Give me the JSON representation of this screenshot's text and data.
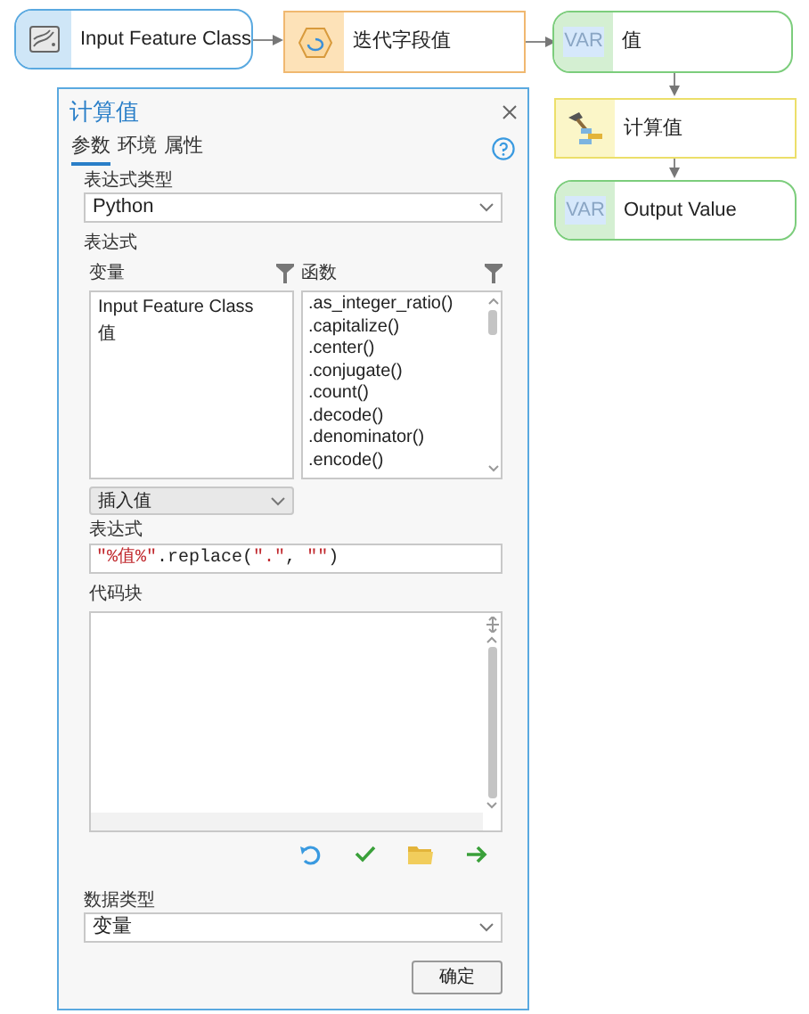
{
  "nodes": [
    {
      "kind": "data",
      "label": "Input Feature Class"
    },
    {
      "kind": "iterator",
      "label": "迭代字段值"
    },
    {
      "kind": "variable",
      "icon_text": "VAR",
      "label": "值"
    },
    {
      "kind": "tool",
      "label": "计算值"
    },
    {
      "kind": "variable",
      "icon_text": "VAR",
      "label": "Output Value"
    }
  ],
  "dialog": {
    "title": "计算值",
    "tabs": [
      {
        "label": "参数",
        "selected": true
      },
      {
        "label": "环境",
        "selected": false
      },
      {
        "label": "属性",
        "selected": false
      }
    ],
    "expression_type": {
      "label": "表达式类型",
      "value": "Python"
    },
    "expression_section": {
      "label": "表达式",
      "variables": {
        "heading": "变量",
        "items": [
          "Input Feature Class",
          "值"
        ]
      },
      "functions": {
        "heading": "函数",
        "items": [
          ".as_integer_ratio()",
          ".capitalize()",
          ".center()",
          ".conjugate()",
          ".count()",
          ".decode()",
          ".denominator()",
          ".encode()"
        ]
      },
      "insert_value": {
        "value": "插入值"
      }
    },
    "expression": {
      "label": "表达式",
      "segments": [
        {
          "kind": "string",
          "text": "\"%值%\""
        },
        {
          "kind": "code",
          "text": ".replace("
        },
        {
          "kind": "string",
          "text": "\".\""
        },
        {
          "kind": "code",
          "text": ", "
        },
        {
          "kind": "string",
          "text": "\"\""
        },
        {
          "kind": "code",
          "text": ")"
        }
      ]
    },
    "code_block": {
      "label": "代码块"
    },
    "data_type": {
      "label": "数据类型",
      "value": "变量"
    },
    "ok_button": "确定"
  }
}
